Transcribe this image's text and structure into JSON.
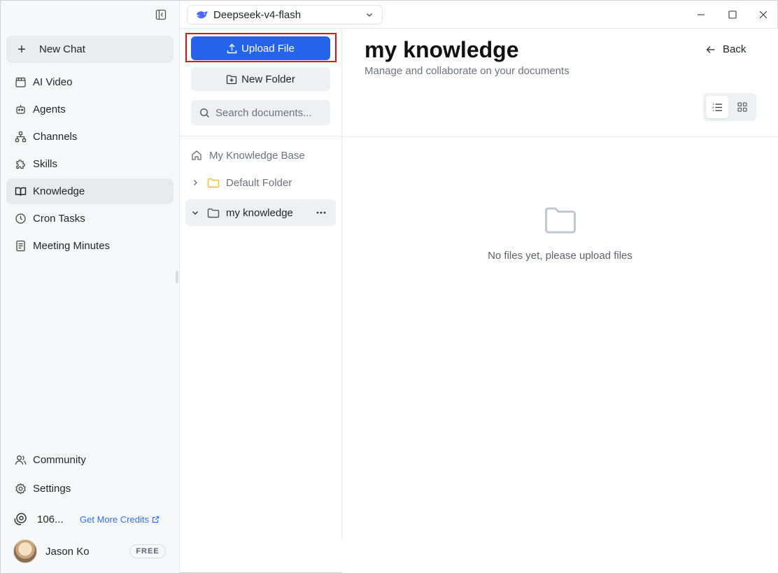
{
  "topbar": {
    "model_name": "Deepseek-v4-flash"
  },
  "sidebar": {
    "new_chat_label": "New Chat",
    "items": [
      {
        "label": "AI Video",
        "icon": "clapperboard-icon"
      },
      {
        "label": "Agents",
        "icon": "robot-icon"
      },
      {
        "label": "Channels",
        "icon": "network-icon"
      },
      {
        "label": "Skills",
        "icon": "puzzle-icon"
      },
      {
        "label": "Knowledge",
        "icon": "book-open-icon",
        "active": true
      },
      {
        "label": "Cron Tasks",
        "icon": "clock-icon"
      },
      {
        "label": "Meeting Minutes",
        "icon": "document-icon"
      }
    ],
    "bottom_items": [
      {
        "label": "Community",
        "icon": "users-icon"
      },
      {
        "label": "Settings",
        "icon": "gear-icon"
      }
    ],
    "credits": {
      "amount": "106...",
      "get_more_label": "Get More Credits"
    },
    "user": {
      "name": "Jason Ko",
      "plan_badge": "FREE"
    }
  },
  "knowledge_panel": {
    "upload_label": "Upload File",
    "new_folder_label": "New Folder",
    "search_placeholder": "Search documents...",
    "tree": {
      "root_label": "My Knowledge Base",
      "folders": [
        {
          "label": "Default Folder",
          "expanded": false,
          "color": "#f5b82e"
        },
        {
          "label": "my knowledge",
          "expanded": true,
          "active": true
        }
      ]
    }
  },
  "main": {
    "title": "my knowledge",
    "subtitle": "Manage and collaborate on your documents",
    "back_label": "Back",
    "view_mode": "list",
    "empty_text": "No files yet, please upload files"
  },
  "colors": {
    "primary": "#2563eb",
    "highlight_outline": "#e0111a",
    "link": "#2f6fe8",
    "folder_yellow": "#f5b82e"
  }
}
